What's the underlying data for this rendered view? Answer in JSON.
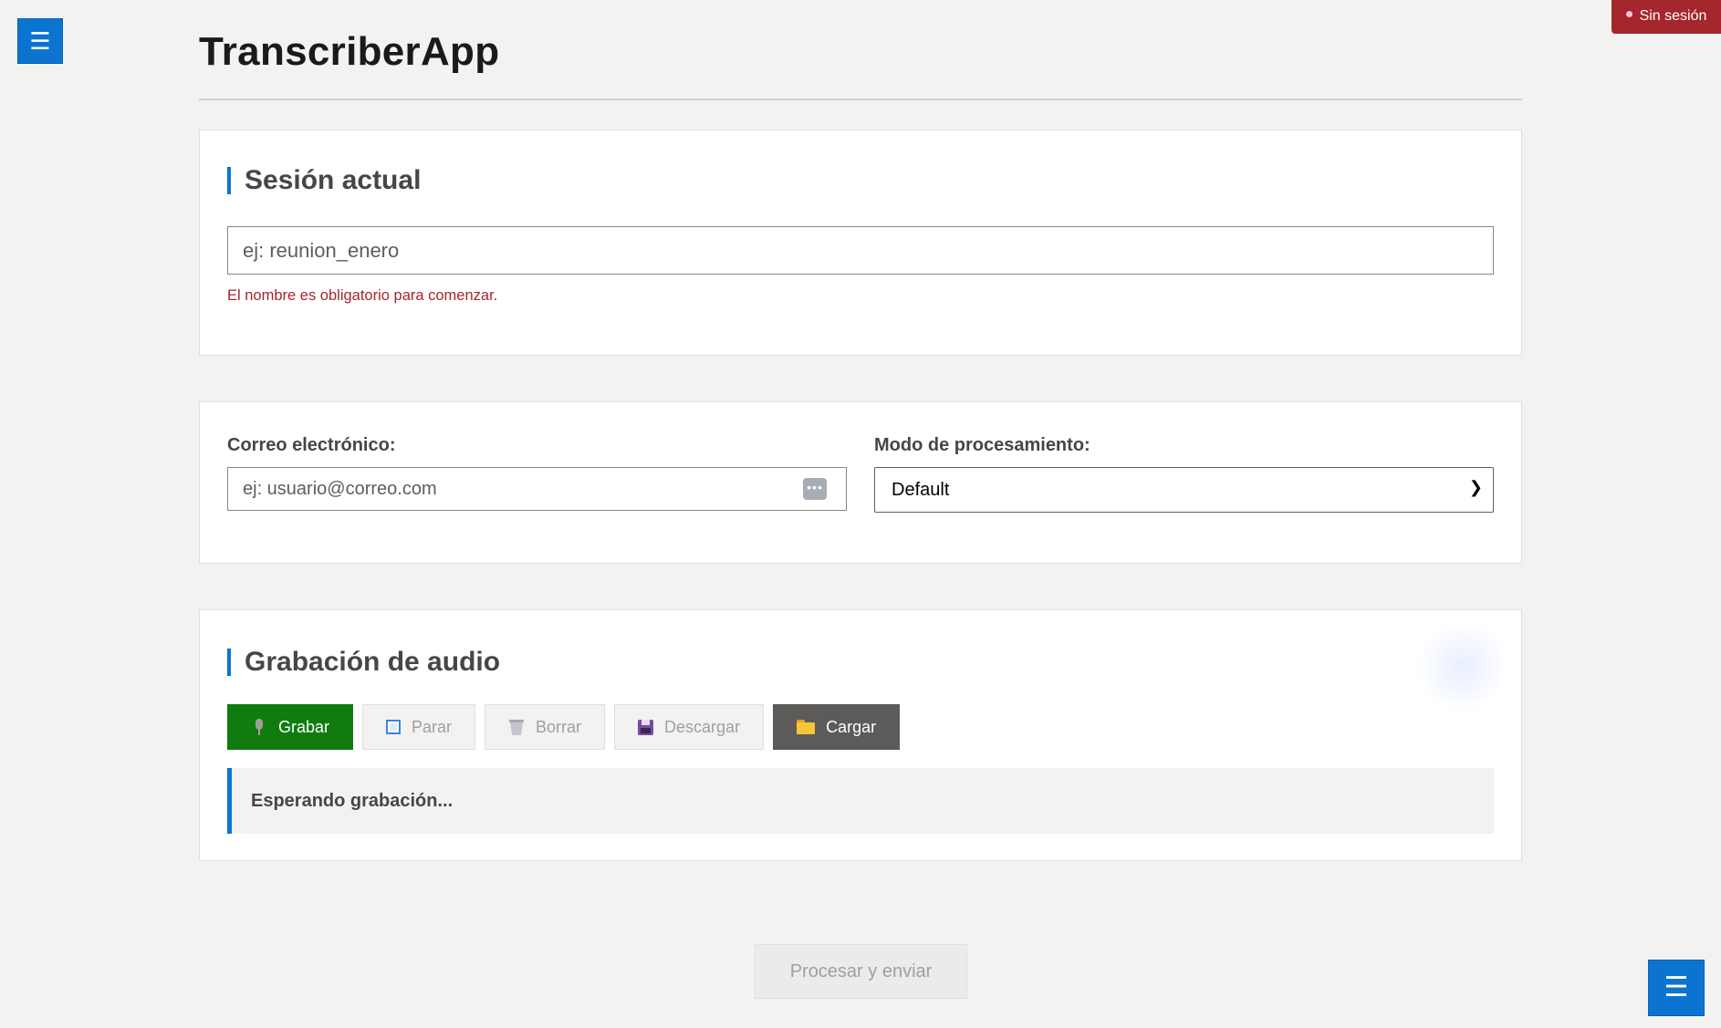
{
  "app": {
    "title": "TranscriberApp",
    "menu_icon": "☰",
    "status_badge": "Sin sesión"
  },
  "session": {
    "title": "Sesión actual",
    "name_placeholder": "ej: reunion_enero",
    "name_value": "",
    "error": "El nombre es obligatorio para comenzar."
  },
  "config": {
    "email_label": "Correo electrónico:",
    "email_placeholder": "ej: usuario@correo.com",
    "email_value": "",
    "mode_label": "Modo de procesamiento:",
    "mode_selected": "Default"
  },
  "audio": {
    "title": "Grabación de audio",
    "buttons": {
      "record": "Grabar",
      "stop": "Parar",
      "delete": "Borrar",
      "download": "Descargar",
      "load": "Cargar"
    },
    "status": "Esperando grabación..."
  },
  "footer": {
    "submit_label": "Procesar y enviar"
  },
  "colors": {
    "accent": "#0b74d1",
    "record": "#107c10",
    "badge": "#a4262c",
    "error": "#a4262c"
  },
  "icons": {
    "menu": "menu-icon",
    "email_helper": "more-icon",
    "select": "chevron-down-icon",
    "record": "microphone-icon",
    "stop": "stop-icon",
    "delete": "trash-icon",
    "download": "floppy-disk-icon",
    "load": "folder-icon"
  }
}
